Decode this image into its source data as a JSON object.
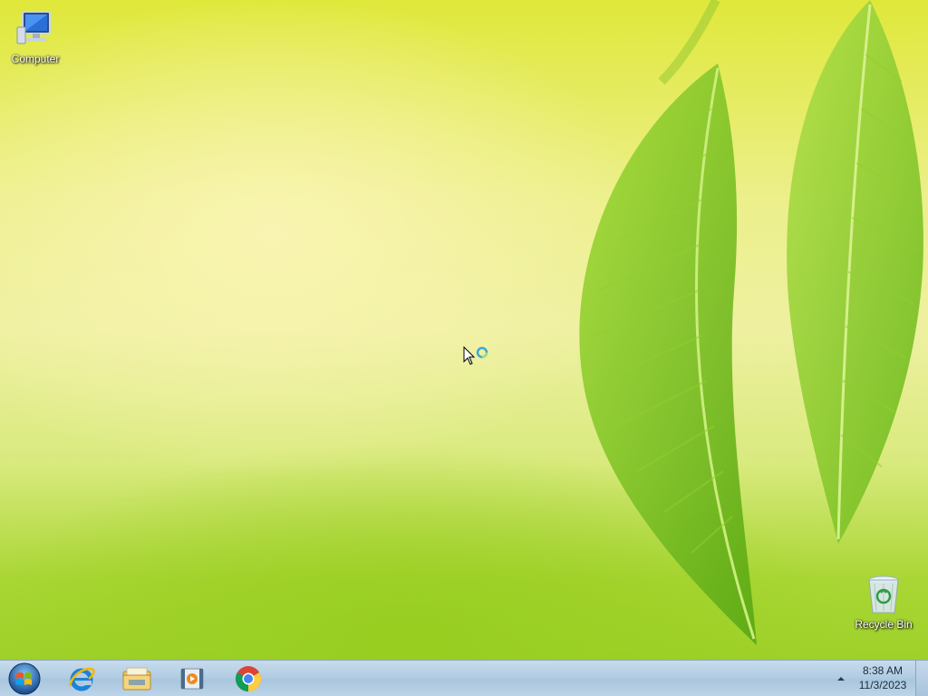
{
  "desktop": {
    "icons": [
      {
        "label": "Computer",
        "icon": "computer-icon"
      },
      {
        "label": "Recycle Bin",
        "icon": "recycle-bin-icon"
      }
    ]
  },
  "taskbar": {
    "start": {
      "icon": "windows-start-orb-icon"
    },
    "pinned": [
      {
        "icon": "internet-explorer-icon"
      },
      {
        "icon": "file-explorer-icon"
      },
      {
        "icon": "media-player-icon"
      },
      {
        "icon": "chrome-icon"
      }
    ],
    "tray": {
      "icon": "show-hidden-icons-arrow-icon"
    },
    "clock": {
      "time": "8:38 AM",
      "date": "11/3/2023"
    }
  },
  "colors": {
    "taskbar": "#b2cde3",
    "wallpaper_top": "#dfe83a",
    "wallpaper_bottom": "#9fd12a",
    "leaf": "#7cc41e"
  }
}
